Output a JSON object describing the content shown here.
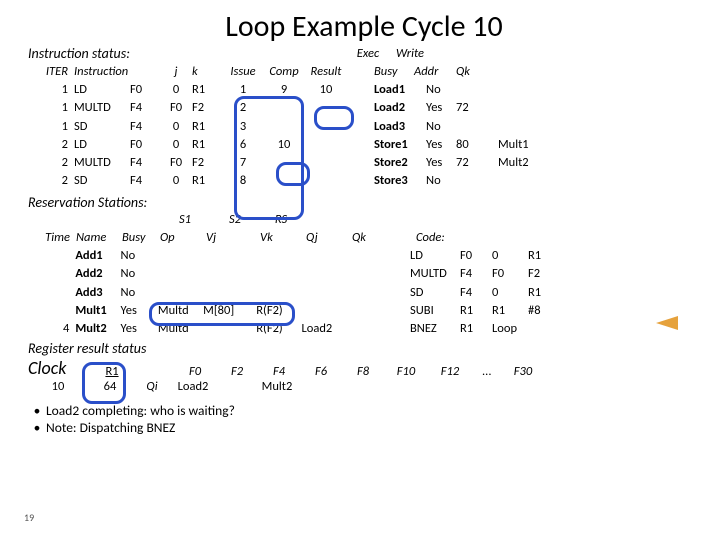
{
  "title": "Loop Example Cycle 10",
  "instr": {
    "heading": "Instruction status:",
    "hdr": {
      "iter": "ITER",
      "instr": "Instruction",
      "j": "j",
      "k": "k",
      "issue": "Issue",
      "exec": "Exec Comp",
      "write": "Write Result",
      "busy": "Busy",
      "addr": "Addr",
      "qk": "Qk",
      "exec1": "Exec",
      "write1": "Write",
      "comp": "Comp",
      "result": "Result"
    },
    "rows": [
      {
        "iter": "1",
        "op": "LD",
        "rd": "F0",
        "j": "0",
        "k": "R1",
        "issue": "1",
        "exec": "9",
        "write": "10",
        "name": "Load1",
        "busy": "No",
        "addr": "",
        "qk": ""
      },
      {
        "iter": "1",
        "op": "MULTD",
        "rd": "F4",
        "j": "F0",
        "k": "F2",
        "issue": "2",
        "exec": "",
        "write": "",
        "name": "Load2",
        "busy": "Yes",
        "addr": "72",
        "qk": ""
      },
      {
        "iter": "1",
        "op": "SD",
        "rd": "F4",
        "j": "0",
        "k": "R1",
        "issue": "3",
        "exec": "",
        "write": "",
        "name": "Load3",
        "busy": "No",
        "addr": "",
        "qk": ""
      },
      {
        "iter": "2",
        "op": "LD",
        "rd": "F0",
        "j": "0",
        "k": "R1",
        "issue": "6",
        "exec": "10",
        "write": "",
        "name": "Store1",
        "busy": "Yes",
        "addr": "80",
        "qk": "Mult1"
      },
      {
        "iter": "2",
        "op": "MULTD",
        "rd": "F4",
        "j": "F0",
        "k": "F2",
        "issue": "7",
        "exec": "",
        "write": "",
        "name": "Store2",
        "busy": "Yes",
        "addr": "72",
        "qk": "Mult2"
      },
      {
        "iter": "2",
        "op": "SD",
        "rd": "F4",
        "j": "0",
        "k": "R1",
        "issue": "8",
        "exec": "",
        "write": "",
        "name": "Store3",
        "busy": "No",
        "addr": "",
        "qk": ""
      }
    ]
  },
  "rs": {
    "heading": "Reservation Stations:",
    "hdr": {
      "time": "Time",
      "name": "Name",
      "busy": "Busy",
      "op": "Op",
      "vj": "Vj",
      "vk": "Vk",
      "qj": "Qj",
      "qk": "Qk",
      "s1": "S1",
      "s2": "S2",
      "rsl": "RS",
      "code": "Code:"
    },
    "rows": [
      {
        "time": "",
        "name": "Add1",
        "busy": "No",
        "op": "",
        "vj": "",
        "vk": "",
        "qj": "",
        "qk": ""
      },
      {
        "time": "",
        "name": "Add2",
        "busy": "No",
        "op": "",
        "vj": "",
        "vk": "",
        "qj": "",
        "qk": ""
      },
      {
        "time": "",
        "name": "Add3",
        "busy": "No",
        "op": "",
        "vj": "",
        "vk": "",
        "qj": "",
        "qk": ""
      },
      {
        "time": "",
        "name": "Mult1",
        "busy": "Yes",
        "op": "Multd",
        "vj": "M[80]",
        "vk": "R(F2)",
        "qj": "",
        "qk": ""
      },
      {
        "time": "4",
        "name": "Mult2",
        "busy": "Yes",
        "op": "Multd",
        "vj": "",
        "vk": "R(F2)",
        "qj": "Load2",
        "qk": ""
      }
    ],
    "code": [
      {
        "op": "LD",
        "a": "F0",
        "b": "0",
        "c": "R1"
      },
      {
        "op": "MULTD",
        "a": "F4",
        "b": "F0",
        "c": "F2"
      },
      {
        "op": "SD",
        "a": "F4",
        "b": "0",
        "c": "R1"
      },
      {
        "op": "SUBI",
        "a": "R1",
        "b": "R1",
        "c": "#8"
      },
      {
        "op": "BNEZ",
        "a": "R1",
        "b": "Loop",
        "c": ""
      }
    ]
  },
  "reg": {
    "heading": "Register result status",
    "clock_label": "Clock",
    "clock": "10",
    "r1_label": "R1",
    "r1": "64",
    "qi": "Qi",
    "cols": [
      "F0",
      "F2",
      "F4",
      "F6",
      "F8",
      "F10",
      "F12",
      "...",
      "F30"
    ],
    "vals": [
      "Load2",
      "",
      "Mult2",
      "",
      "",
      "",
      "",
      "",
      ""
    ]
  },
  "bullets": [
    "Load2 completing: who is waiting?",
    "Note: Dispatching BNEZ"
  ],
  "slidenum": "19",
  "chart_data": {
    "type": "table",
    "title": "Loop Example Cycle 10",
    "instruction_status": [
      {
        "iter": 1,
        "instr": "LD F0,0,R1",
        "issue": 1,
        "exec_comp": 9,
        "write": 10,
        "unit": "Load1",
        "busy": "No"
      },
      {
        "iter": 1,
        "instr": "MULTD F4,F0,F2",
        "issue": 2,
        "unit": "Load2",
        "busy": "Yes",
        "addr": 72
      },
      {
        "iter": 1,
        "instr": "SD F4,0,R1",
        "issue": 3,
        "unit": "Load3",
        "busy": "No"
      },
      {
        "iter": 2,
        "instr": "LD F0,0,R1",
        "issue": 6,
        "exec_comp": 10,
        "unit": "Store1",
        "busy": "Yes",
        "addr": 80,
        "qk": "Mult1"
      },
      {
        "iter": 2,
        "instr": "MULTD F4,F0,F2",
        "issue": 7,
        "unit": "Store2",
        "busy": "Yes",
        "addr": 72,
        "qk": "Mult2"
      },
      {
        "iter": 2,
        "instr": "SD F4,0,R1",
        "issue": 8,
        "unit": "Store3",
        "busy": "No"
      }
    ],
    "reservation_stations": [
      {
        "name": "Add1",
        "busy": "No"
      },
      {
        "name": "Add2",
        "busy": "No"
      },
      {
        "name": "Add3",
        "busy": "No"
      },
      {
        "time": null,
        "name": "Mult1",
        "busy": "Yes",
        "op": "Multd",
        "vj": "M[80]",
        "vk": "R(F2)"
      },
      {
        "time": 4,
        "name": "Mult2",
        "busy": "Yes",
        "op": "Multd",
        "vk": "R(F2)",
        "qj": "Load2"
      }
    ],
    "register_result": {
      "clock": 10,
      "R1": 64,
      "F0": "Load2",
      "F4": "Mult2"
    }
  }
}
